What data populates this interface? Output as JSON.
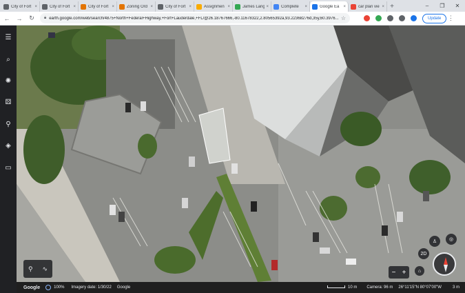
{
  "tabs": [
    {
      "title": "City of Fort",
      "color": "#5f6368",
      "active": false
    },
    {
      "title": "City of Fort",
      "color": "#5f6368",
      "active": false
    },
    {
      "title": "City of Fort",
      "color": "#e37400",
      "active": false
    },
    {
      "title": "Zoning Ord",
      "color": "#e37400",
      "active": false
    },
    {
      "title": "City of Fort",
      "color": "#5f6368",
      "active": false
    },
    {
      "title": "Assignmen",
      "color": "#f9ab00",
      "active": false
    },
    {
      "title": "James Lang",
      "color": "#34a853",
      "active": false
    },
    {
      "title": "Complete",
      "color": "#4285f4",
      "active": false
    },
    {
      "title": "Google Ea",
      "color": "#1a73e8",
      "active": true
    },
    {
      "title": "car plan vie",
      "color": "#ea4335",
      "active": false
    }
  ],
  "toolbar": {
    "url": "earth.google.com/web/search/4875+North+Federal+Highway,+Fort+Lauderdale,+FL/@26.18767666,-80.11678322,2.80565392a,93.22368276d,35y,60.3976...",
    "update_label": "Update",
    "extension_colors": [
      "#ea4335",
      "#34a853",
      "#5f6368",
      "#5f6368",
      "#1a73e8"
    ]
  },
  "rail": {
    "icons": [
      "menu-icon",
      "search-icon",
      "voyager-icon",
      "feeling-lucky-icon",
      "projects-icon",
      "layers-icon",
      "measure-icon"
    ]
  },
  "status": {
    "google_label": "Google",
    "zoom": "100%",
    "imagery_date": "Imagery date: 1/30/22",
    "google_credit": "Google",
    "scale": "10 m",
    "camera": "Camera: 96 m",
    "coords": "26°11'15\"N 80°07'00\"W",
    "elevation": "3 m"
  },
  "controls": {
    "view_2d": "2D"
  }
}
